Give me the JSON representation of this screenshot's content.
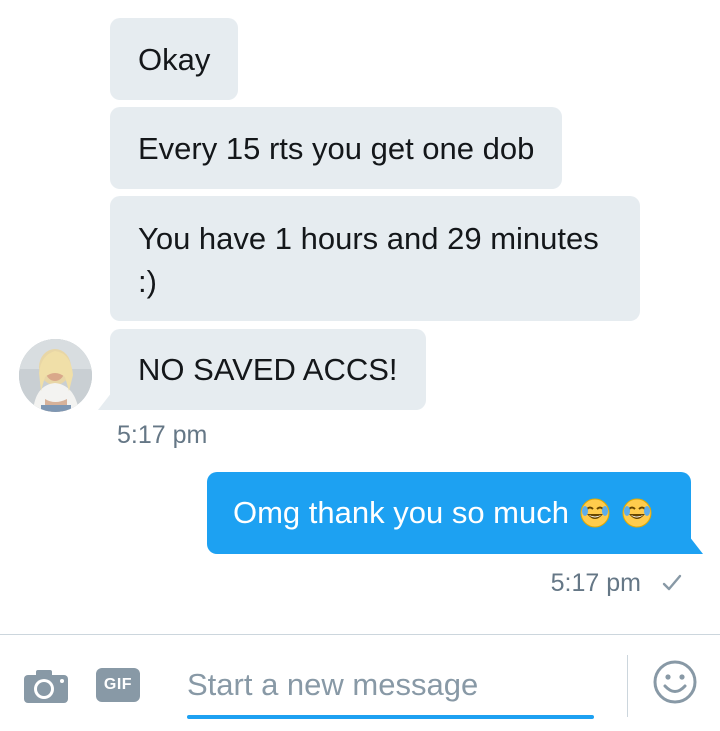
{
  "conversation": {
    "incoming": [
      {
        "text": "Okay"
      },
      {
        "text": "Every 15 rts you get one dob"
      },
      {
        "text": "You have 1 hours and 29 minutes :)"
      },
      {
        "text": "NO SAVED ACCS!"
      }
    ],
    "incoming_time": "5:17 pm",
    "outgoing": {
      "text": "Omg thank you so much",
      "emojis": [
        "face-with-tears-of-joy",
        "face-with-tears-of-joy"
      ]
    },
    "outgoing_time": "5:17 pm",
    "outgoing_status": "sent-check-icon"
  },
  "composer": {
    "camera_icon": "camera-icon",
    "gif_label": "GIF",
    "placeholder": "Start a new message",
    "value": "",
    "emoji_icon": "smiley-icon"
  },
  "colors": {
    "incoming_bubble": "#e6ecf0",
    "outgoing_bubble": "#1da1f2",
    "meta_text": "#657786",
    "icon_gray": "#8899a6"
  }
}
